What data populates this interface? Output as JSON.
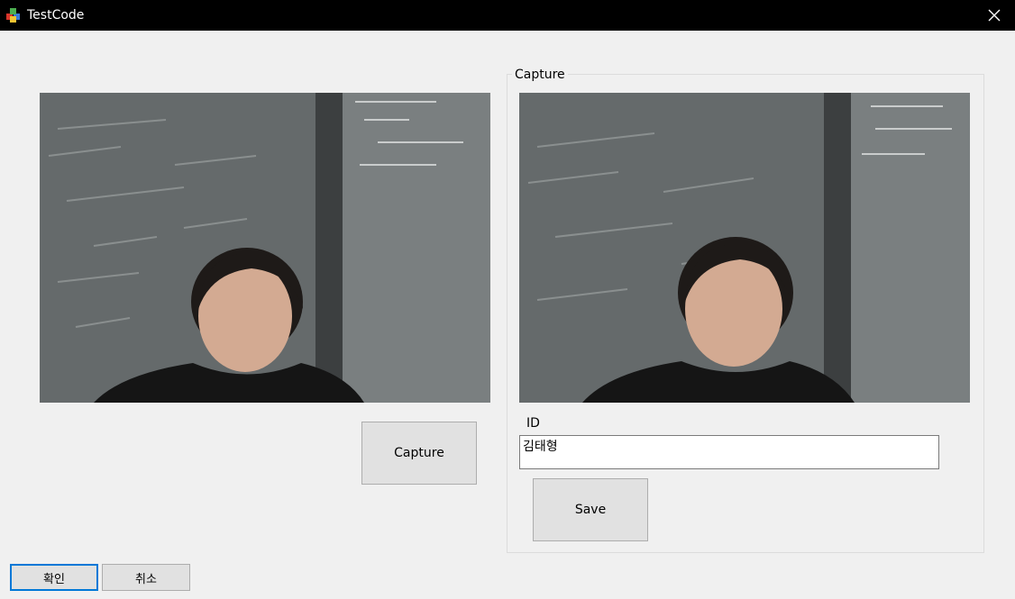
{
  "window": {
    "title": "TestCode",
    "app_icon": "app-cube-icon",
    "close_icon": "close-icon"
  },
  "left_panel": {
    "capture_button": "Capture"
  },
  "capture_group": {
    "legend": "Capture",
    "id_label": "ID",
    "id_value": "김태형",
    "save_button": "Save"
  },
  "footer": {
    "ok_button": "확인",
    "cancel_button": "취소"
  },
  "colors": {
    "accent": "#0078d7",
    "titlebar": "#000000",
    "window_bg": "#f0f0f0",
    "button_bg": "#e1e1e1"
  }
}
